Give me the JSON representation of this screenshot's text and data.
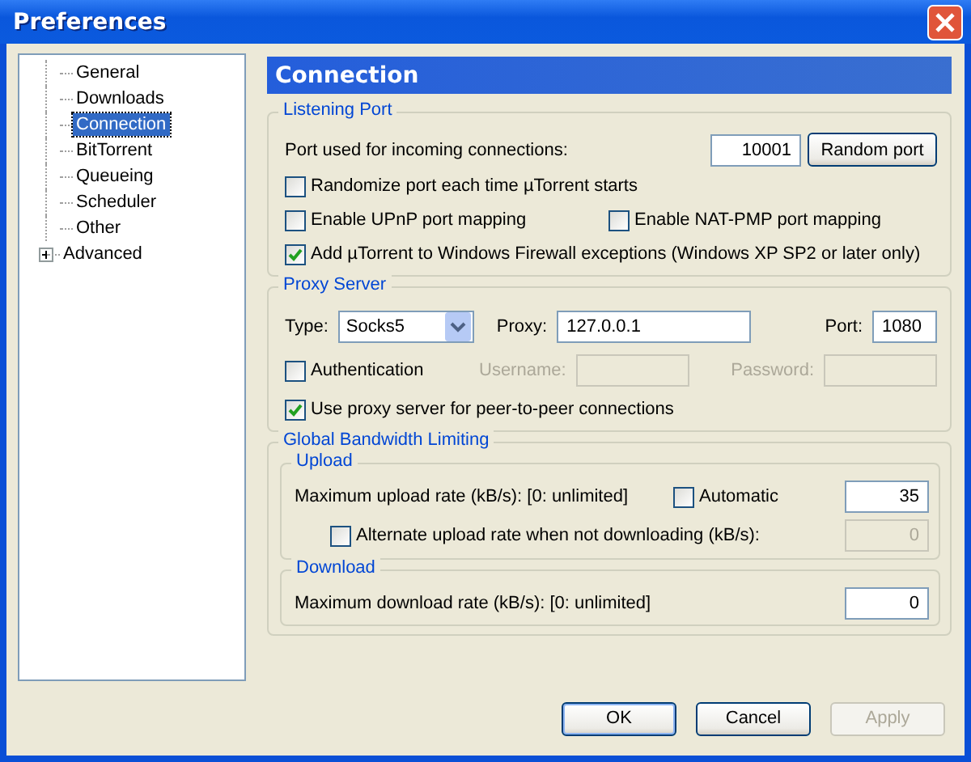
{
  "window": {
    "title": "Preferences"
  },
  "tree": [
    {
      "label": "General",
      "kind": "leaf",
      "selected": false
    },
    {
      "label": "Downloads",
      "kind": "leaf",
      "selected": false
    },
    {
      "label": "Connection",
      "kind": "leaf",
      "selected": true
    },
    {
      "label": "BitTorrent",
      "kind": "leaf",
      "selected": false
    },
    {
      "label": "Queueing",
      "kind": "leaf",
      "selected": false
    },
    {
      "label": "Scheduler",
      "kind": "leaf",
      "selected": false
    },
    {
      "label": "Other",
      "kind": "leaf",
      "selected": false
    },
    {
      "label": "Advanced",
      "kind": "branch",
      "selected": false
    }
  ],
  "header": "Connection",
  "listening_port": {
    "legend": "Listening Port",
    "port_label": "Port used for incoming connections:",
    "port_value": "10001",
    "random_button": "Random port",
    "rows": [
      [
        {
          "label": "Randomize port each time µTorrent starts",
          "checked": false
        }
      ],
      [
        {
          "label": "Enable UPnP port mapping",
          "checked": false
        },
        {
          "label": "Enable NAT-PMP port mapping",
          "checked": false
        }
      ],
      [
        {
          "label": "Add µTorrent to Windows Firewall exceptions (Windows XP SP2 or later only)",
          "checked": true
        }
      ]
    ]
  },
  "proxy": {
    "legend": "Proxy Server",
    "type_label": "Type:",
    "type_value": "Socks5",
    "proxy_label": "Proxy:",
    "proxy_value": "127.0.0.1",
    "port_label": "Port:",
    "port_value": "1080",
    "authentication": {
      "label": "Authentication",
      "checked": false
    },
    "username_label": "Username:",
    "password_label": "Password:",
    "peer": {
      "label": "Use proxy server for peer-to-peer connections",
      "checked": true
    }
  },
  "bandwidth": {
    "legend": "Global Bandwidth Limiting",
    "upload": {
      "legend": "Upload",
      "max_label": "Maximum upload rate (kB/s): [0: unlimited]",
      "automatic": {
        "label": "Automatic",
        "checked": false
      },
      "value": "35",
      "alternate": {
        "label": "Alternate upload rate when not downloading (kB/s):",
        "checked": false
      },
      "alternate_value": "0"
    },
    "download": {
      "legend": "Download",
      "max_label": "Maximum download rate (kB/s): [0: unlimited]",
      "value": "0"
    }
  },
  "buttons": [
    {
      "label": "OK",
      "disabled": false,
      "default": true
    },
    {
      "label": "Cancel",
      "disabled": false,
      "default": false
    },
    {
      "label": "Apply",
      "disabled": true,
      "default": false
    }
  ]
}
